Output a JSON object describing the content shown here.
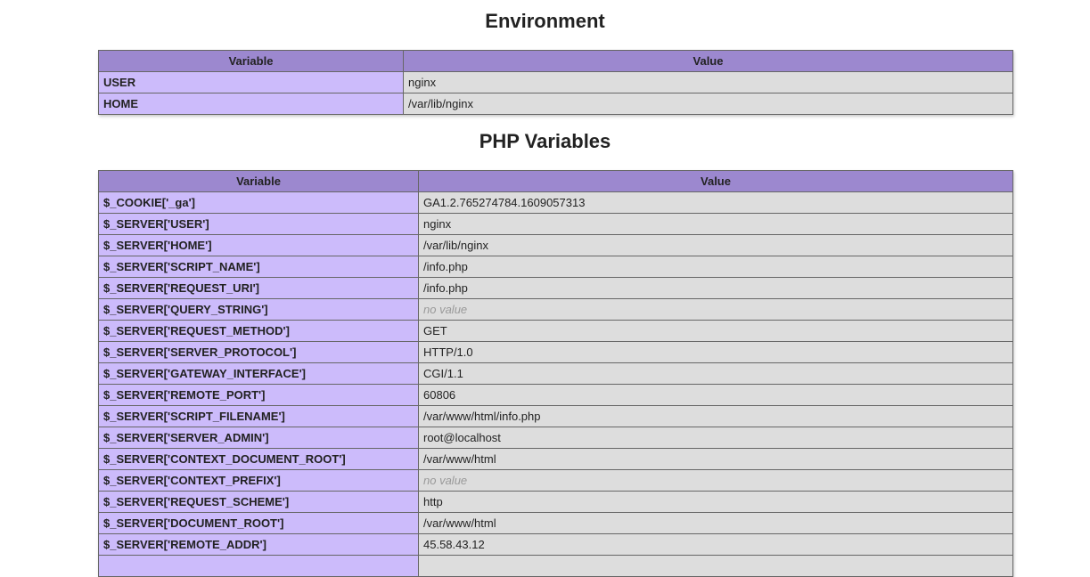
{
  "environment": {
    "title": "Environment",
    "headers": {
      "variable": "Variable",
      "value": "Value"
    },
    "rows": [
      {
        "name": "USER",
        "value": "nginx"
      },
      {
        "name": "HOME",
        "value": "/var/lib/nginx"
      }
    ]
  },
  "php_variables": {
    "title": "PHP Variables",
    "headers": {
      "variable": "Variable",
      "value": "Value"
    },
    "rows": [
      {
        "name": "$_COOKIE['_ga']",
        "value": "GA1.2.765274784.1609057313"
      },
      {
        "name": "$_SERVER['USER']",
        "value": "nginx"
      },
      {
        "name": "$_SERVER['HOME']",
        "value": "/var/lib/nginx"
      },
      {
        "name": "$_SERVER['SCRIPT_NAME']",
        "value": "/info.php"
      },
      {
        "name": "$_SERVER['REQUEST_URI']",
        "value": "/info.php"
      },
      {
        "name": "$_SERVER['QUERY_STRING']",
        "value": "no value",
        "no_value": true
      },
      {
        "name": "$_SERVER['REQUEST_METHOD']",
        "value": "GET"
      },
      {
        "name": "$_SERVER['SERVER_PROTOCOL']",
        "value": "HTTP/1.0"
      },
      {
        "name": "$_SERVER['GATEWAY_INTERFACE']",
        "value": "CGI/1.1"
      },
      {
        "name": "$_SERVER['REMOTE_PORT']",
        "value": "60806"
      },
      {
        "name": "$_SERVER['SCRIPT_FILENAME']",
        "value": "/var/www/html/info.php"
      },
      {
        "name": "$_SERVER['SERVER_ADMIN']",
        "value": "root@localhost"
      },
      {
        "name": "$_SERVER['CONTEXT_DOCUMENT_ROOT']",
        "value": "/var/www/html"
      },
      {
        "name": "$_SERVER['CONTEXT_PREFIX']",
        "value": "no value",
        "no_value": true
      },
      {
        "name": "$_SERVER['REQUEST_SCHEME']",
        "value": "http"
      },
      {
        "name": "$_SERVER['DOCUMENT_ROOT']",
        "value": "/var/www/html"
      },
      {
        "name": "$_SERVER['REMOTE_ADDR']",
        "value": "45.58.43.12"
      },
      {
        "name": "",
        "value": ""
      }
    ]
  },
  "colors": {
    "header_bg": "#9c88cf",
    "key_cell_bg": "#ccbbfb",
    "value_cell_bg": "#dddddd",
    "no_value_text": "#999999"
  }
}
